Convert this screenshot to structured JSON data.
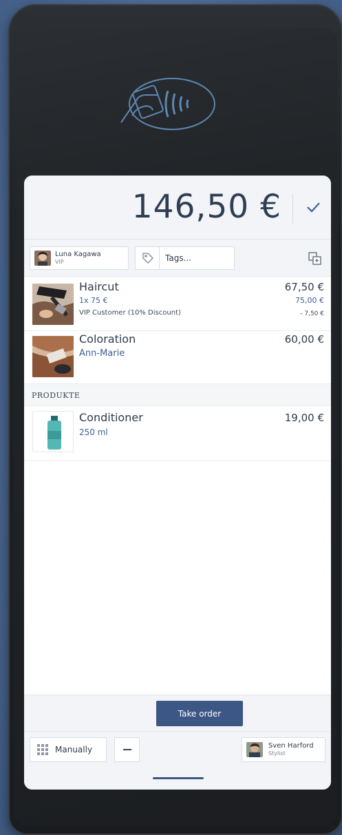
{
  "order": {
    "total": "146,50 €"
  },
  "customer": {
    "name": "Luna Kagawa",
    "status": "VIP"
  },
  "tags": {
    "placeholder": "Tags..."
  },
  "items": [
    {
      "title": "Haircut",
      "line1": "1x 75 €",
      "line2": "VIP Customer (10% Discount)",
      "price": "67,50 €",
      "price_sub1": "75,00 €",
      "price_sub2": "- 7,50 €"
    },
    {
      "title": "Coloration",
      "line1": "Ann-Marie",
      "price": "60,00 €"
    }
  ],
  "products_section": {
    "label": "PRODUKTE",
    "items": [
      {
        "title": "Conditioner",
        "line1": "250 ml",
        "price": "19,00 €"
      }
    ]
  },
  "actions": {
    "take_order": "Take order",
    "manually": "Manually"
  },
  "stylist": {
    "name": "Sven Harford",
    "role": "Stylist"
  },
  "colors": {
    "accent": "#3c5685",
    "link": "#3d5f94",
    "background": "#4d6a94"
  }
}
